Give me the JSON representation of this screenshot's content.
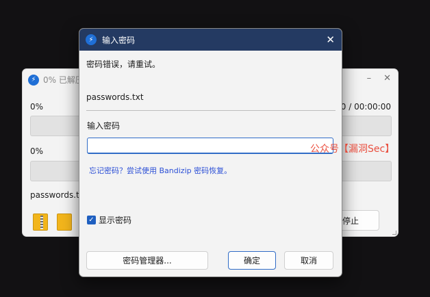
{
  "bg_window": {
    "title": "0% 已解压",
    "minimize_glyph": "–",
    "close_glyph": "✕",
    "row1": {
      "percent": "0%",
      "time": "00:00:00 / 00:00:00"
    },
    "row2": {
      "percent": "0%"
    },
    "filename": "passwords.txt",
    "stop_label": "停止"
  },
  "dialog": {
    "title": "输入密码",
    "close_glyph": "✕",
    "error_text": "密码错误，请重试。",
    "file_name": "passwords.txt",
    "password_label": "输入密码",
    "password_value": "",
    "forgot_link": "忘记密码？尝试使用 Bandizip 密码恢复。",
    "show_password_label": "显示密码",
    "show_password_checked": true,
    "manager_button": "密码管理器...",
    "ok_button": "确定",
    "cancel_button": "取消"
  },
  "watermark": {
    "text": "公众号【漏洞Sec】"
  },
  "colors": {
    "title_bar": "#243a62",
    "accent": "#1f5fc0",
    "link": "#2b4fd6",
    "watermark": "#e8321f"
  },
  "icons": {
    "app_logo": "bandizip-logo-icon",
    "folder": "zip-folder-icon"
  }
}
